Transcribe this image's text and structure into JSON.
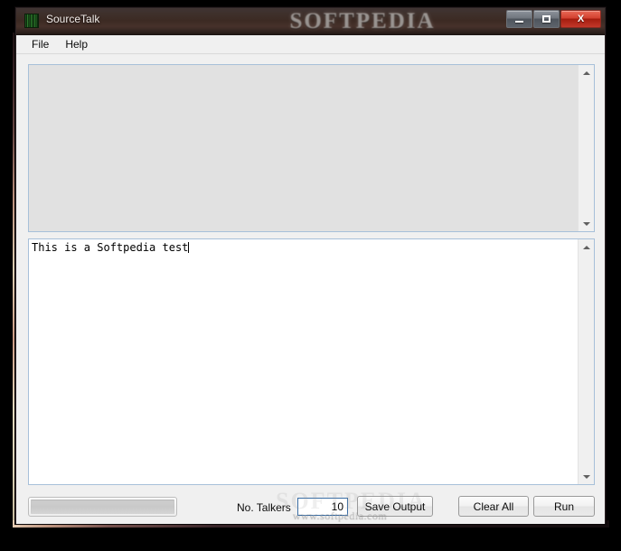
{
  "window": {
    "title": "SourceTalk",
    "icon": "striped-green-app-icon",
    "watermark_title": "SOFTPEDIA",
    "watermark_url": "www.softpedia.com",
    "controls": {
      "minimize_label": "Minimize",
      "maximize_label": "Maximize",
      "close_label": "X"
    }
  },
  "menubar": {
    "items": [
      {
        "label": "File"
      },
      {
        "label": "Help"
      }
    ]
  },
  "output_area": {
    "value": "",
    "readonly": true,
    "scrollbar": {
      "up": "scroll-up",
      "down": "scroll-down"
    }
  },
  "input_area": {
    "value": "This is a Softpedia test",
    "readonly": false,
    "caret_visible": true,
    "scrollbar": {
      "up": "scroll-up",
      "down": "scroll-down"
    }
  },
  "bottombar": {
    "progress": {
      "value": 0,
      "max": 100
    },
    "talkers_label": "No. Talkers",
    "talkers_value": "10",
    "talkers_placeholder": "",
    "save_output_label": "Save Output",
    "clear_all_label": "Clear All",
    "run_label": "Run"
  },
  "colors": {
    "titlebar": "#3c2a23",
    "close_button": "#c3382a",
    "window_bg": "#f0f0f0",
    "textbox_border": "#a7c0d9",
    "readonly_bg": "#e1e1e1",
    "input_focus_border": "#3b6ea5"
  }
}
